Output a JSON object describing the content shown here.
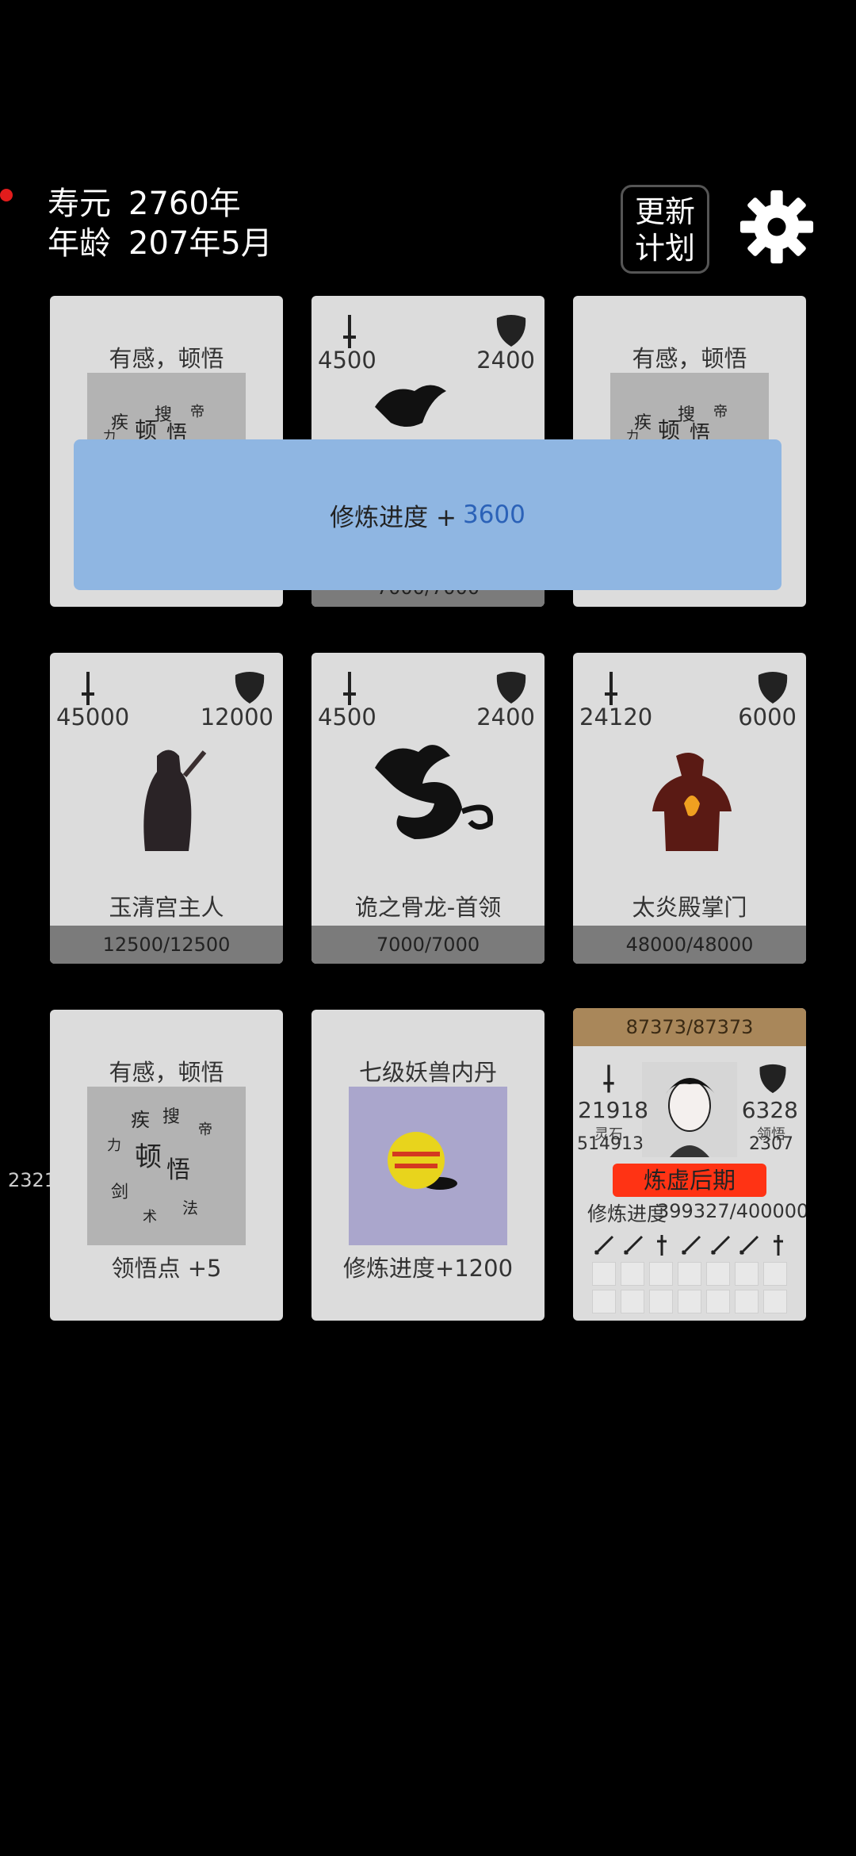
{
  "hud": {
    "lifespan_label": "寿元",
    "lifespan_value": "2760年",
    "age_label": "年龄",
    "age_value": "207年5月"
  },
  "buttons": {
    "update_plan": "更新\n计划",
    "update_line1": "更新",
    "update_line2": "计划"
  },
  "popup": {
    "label": "修炼进度 +",
    "value": "3600"
  },
  "side_number": "2321",
  "cards": {
    "r1c1": {
      "title": "有感，顿悟"
    },
    "r1c2": {
      "atk": "4500",
      "def": "2400",
      "footer": "7000/7000"
    },
    "r1c3": {
      "title": "有感，顿悟"
    },
    "r2c1": {
      "atk": "45000",
      "def": "12000",
      "name": "玉清宫主人",
      "footer": "12500/12500"
    },
    "r2c2": {
      "atk": "4500",
      "def": "2400",
      "name": "诡之骨龙-首领",
      "footer": "7000/7000"
    },
    "r2c3": {
      "atk": "24120",
      "def": "6000",
      "name": "太炎殿掌门",
      "footer": "48000/48000"
    },
    "r3c1": {
      "title": "有感，顿悟",
      "caption": "领悟点  +5"
    },
    "r3c2": {
      "title": "七级妖兽内丹",
      "caption": "修炼进度+1200"
    }
  },
  "player": {
    "hp": "87373/87373",
    "atk": "21918",
    "def": "6328",
    "spirit_stone_label": "灵石",
    "spirit_stone": "514913",
    "insight_label": "领悟",
    "insight": "2307",
    "realm": "炼虚后期",
    "progress_label": "修炼进度",
    "progress": "399327/400000"
  },
  "icons": [
    "sword-icon",
    "shield-icon",
    "gear-icon",
    "dragon-icon",
    "calligraphy-icon",
    "beast-core-icon",
    "weapon-icon"
  ]
}
